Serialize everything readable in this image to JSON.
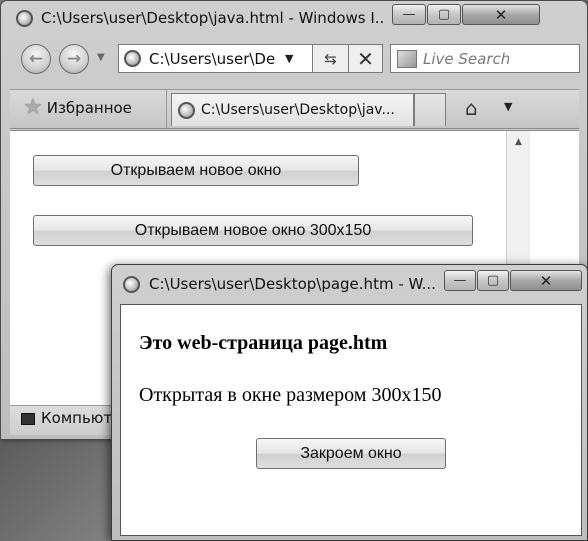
{
  "main_window": {
    "title": "C:\\Users\\user\\Desktop\\java.html - Windows I...",
    "caption_buttons": {
      "minimize": "—",
      "maximize": "▢",
      "close": "✕"
    },
    "address": "C:\\Users\\user\\De",
    "search_placeholder": "Live Search",
    "favorites_label": "Избранное",
    "tab_title": "C:\\Users\\user\\Desktop\\jav...",
    "buttons": [
      {
        "label": "Открываем новое окно"
      },
      {
        "label": "Открываем новое окно 300x150"
      }
    ],
    "status_text": "Компьют"
  },
  "popup_window": {
    "title": "C:\\Users\\user\\Desktop\\page.htm - W...",
    "heading": "Это web-страница page.htm",
    "text": "Открытая в окне размером 300x150",
    "close_button": "Закроем окно"
  },
  "icons": [
    "ie-icon",
    "back-arrow-icon",
    "forward-arrow-icon",
    "dropdown-icon",
    "refresh-icon",
    "stop-icon",
    "search-provider-icon",
    "favorites-star-icon",
    "home-icon",
    "computer-icon",
    "scroll-up-icon"
  ]
}
